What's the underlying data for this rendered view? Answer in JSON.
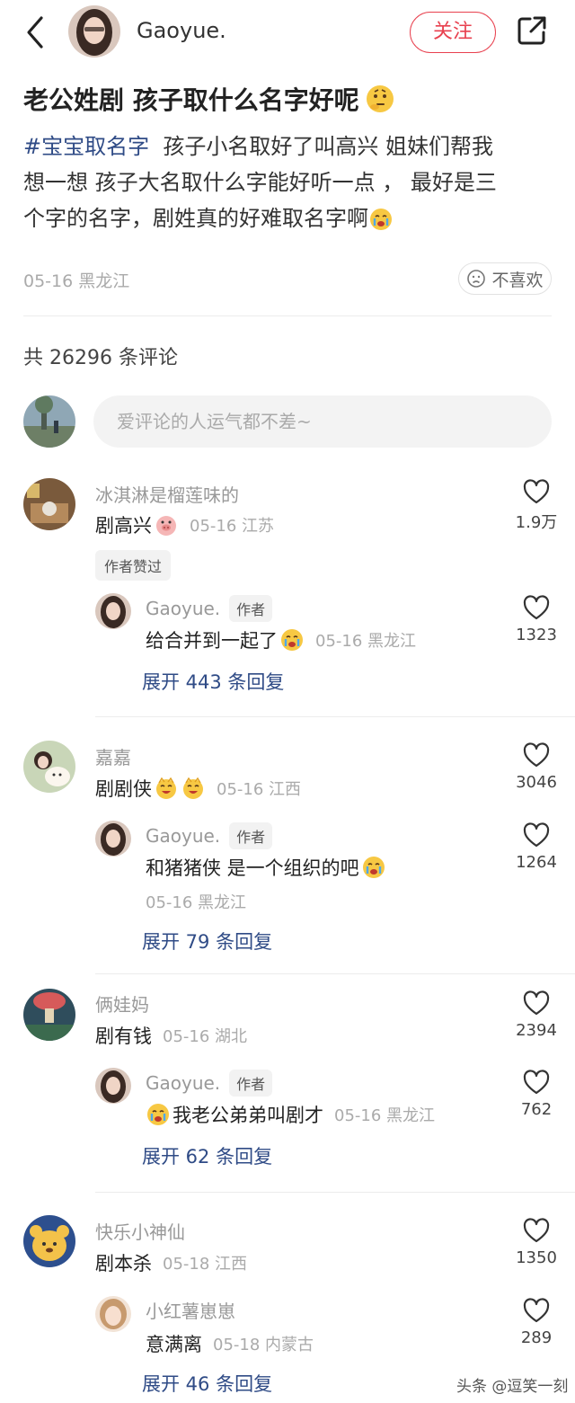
{
  "header": {
    "author_name": "Gaoyue.",
    "follow_label": "关注"
  },
  "post": {
    "title": "老公姓剧 孩子取什么名字好呢",
    "hashtag": "#宝宝取名字",
    "line1": "孩子小名取好了叫高兴  姐妹们帮我",
    "line2": "想一想 孩子大名取什么字能好听一点 ，  最好是三",
    "line3": "个字的名字，剧姓真的好难取名字啊",
    "meta": "05-16 黑龙江",
    "dislike_label": "不喜欢"
  },
  "comments_header": {
    "count_text": "共 26296 条评论",
    "input_placeholder": "爱评论的人运气都不差~"
  },
  "comments": [
    {
      "user": "冰淇淋是榴莲味的",
      "text": "剧高兴",
      "when": "05-16 江苏",
      "likes": "1.9万",
      "badge": "作者赞过",
      "reply": {
        "user": "Gaoyue.",
        "tag": "作者",
        "text": "给合并到一起了",
        "when": "05-16 黑龙江",
        "likes": "1323"
      },
      "expand": "展开 443 条回复"
    },
    {
      "user": "嘉嘉",
      "text": "剧剧侠",
      "when": "05-16 江西",
      "likes": "3046",
      "reply": {
        "user": "Gaoyue.",
        "tag": "作者",
        "text": "和猪猪侠 是一个组织的吧",
        "when": "05-16 黑龙江",
        "likes": "1264"
      },
      "expand": "展开 79 条回复"
    },
    {
      "user": "俩娃妈",
      "text": "剧有钱",
      "when": "05-16 湖北",
      "likes": "2394",
      "reply": {
        "user": "Gaoyue.",
        "tag": "作者",
        "text": "我老公弟弟叫剧才",
        "when": "05-16 黑龙江",
        "likes": "762"
      },
      "expand": "展开 62 条回复"
    },
    {
      "user": "快乐小神仙",
      "text": "剧本杀",
      "when": "05-18 江西",
      "likes": "1350",
      "reply": {
        "user": "小红薯崽崽",
        "text": "意满离",
        "when": "05-18 内蒙古",
        "likes": "289"
      },
      "expand": "展开 46 条回复"
    }
  ],
  "watermark": "头条 @逗笑一刻",
  "colors": {
    "accent": "#e8414f",
    "link": "#2f4b86"
  }
}
